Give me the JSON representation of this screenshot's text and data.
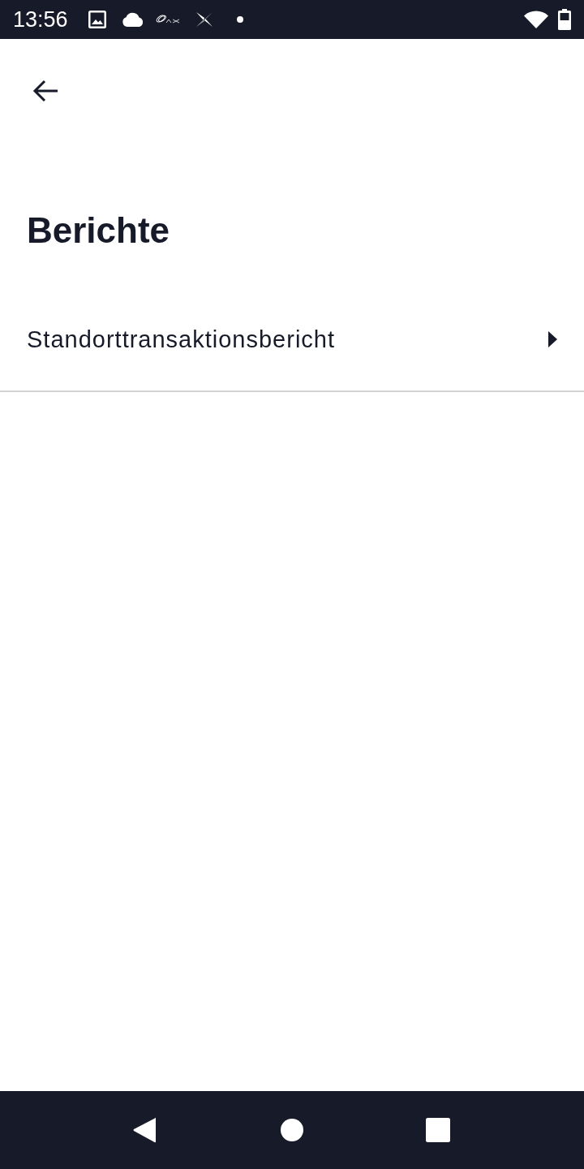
{
  "status_bar": {
    "time": "13:56"
  },
  "title": "Berichte",
  "items": [
    {
      "label": "Standorttransaktionsbericht"
    }
  ]
}
